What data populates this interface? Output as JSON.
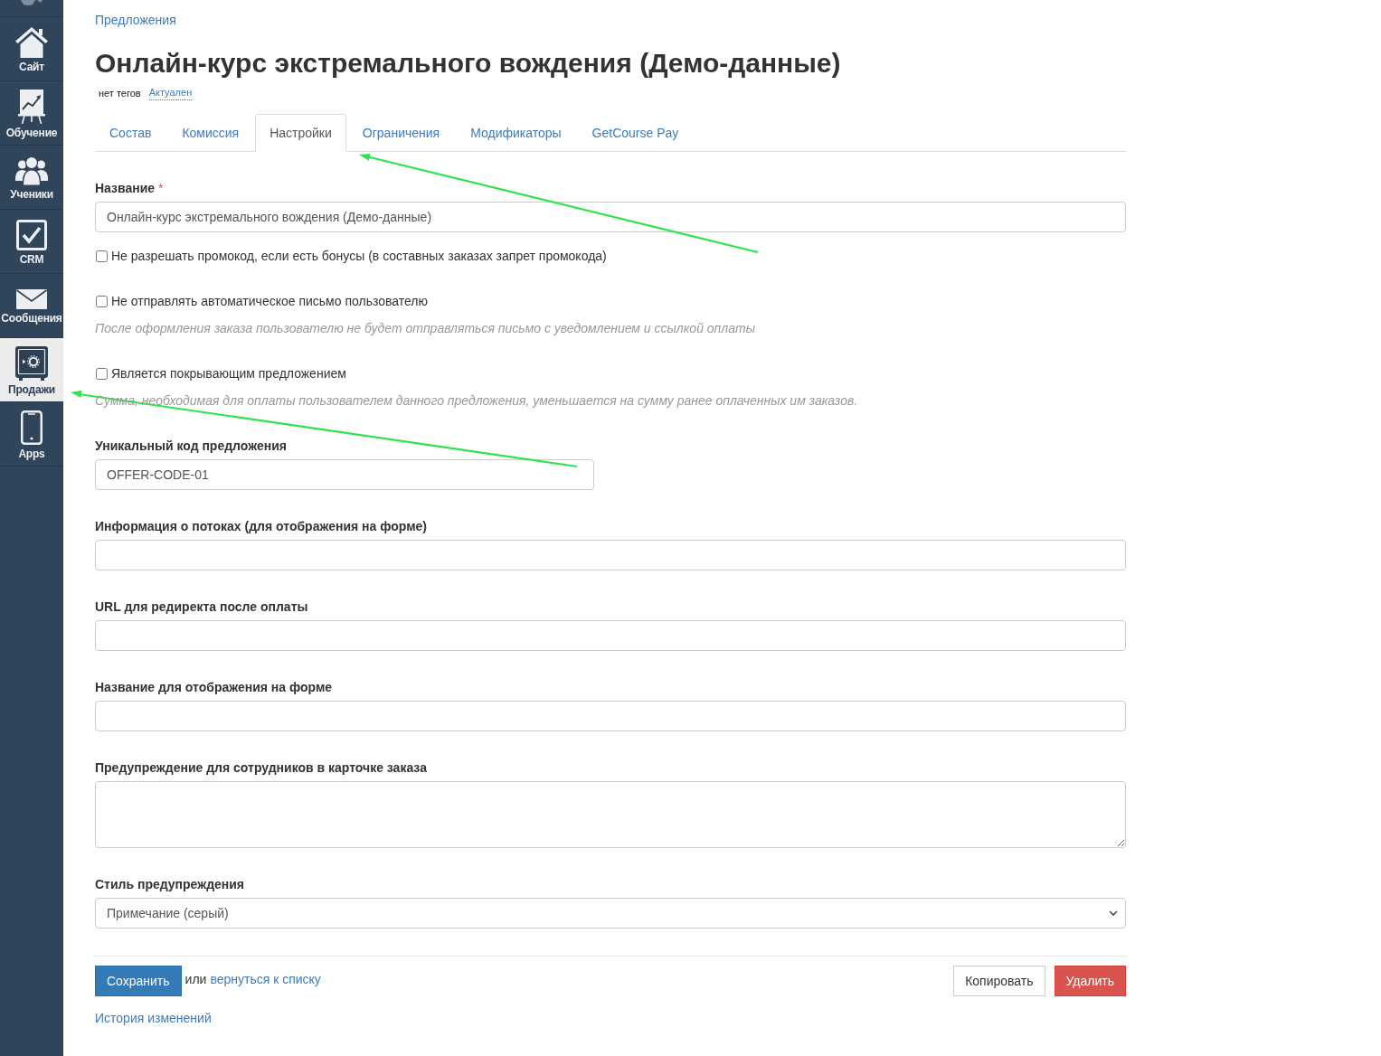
{
  "sidebar": {
    "items": [
      {
        "label": "Сайт",
        "selected": false
      },
      {
        "label": "Обучение",
        "selected": false
      },
      {
        "label": "Ученики",
        "selected": false
      },
      {
        "label": "CRM",
        "selected": false
      },
      {
        "label": "Сообщения",
        "selected": false
      },
      {
        "label": "Продажи",
        "selected": true
      },
      {
        "label": "Apps",
        "selected": false
      }
    ]
  },
  "breadcrumb": "Предложения",
  "title": "Онлайн-курс экстремального вождения (Демо-данные)",
  "tags": {
    "text": "нет тегов",
    "status": "Актуален"
  },
  "tabs": [
    {
      "label": "Состав",
      "selected": false
    },
    {
      "label": "Комиссия",
      "selected": false
    },
    {
      "label": "Настройки",
      "selected": true
    },
    {
      "label": "Ограничения",
      "selected": false
    },
    {
      "label": "Модификаторы",
      "selected": false
    },
    {
      "label": "GetCourse Pay",
      "selected": false
    }
  ],
  "form": {
    "name": {
      "label": "Название",
      "required_mark": "*",
      "value": "Онлайн-курс экстремального вождения (Демо-данные)"
    },
    "options": [
      {
        "label": "Не разрешать промокод, если есть бонусы (в составных заказах запрет промокода)",
        "checked": false
      },
      {
        "label": "Не отправлять автоматическое письмо пользователю",
        "checked": false,
        "hint": "После оформления заказа пользователю не будет отправляться письмо с уведомлением и ссылкой оплаты"
      },
      {
        "label": "Является покрывающим предложением",
        "checked": false,
        "hint": "Сумма, необходимая для оплаты пользователем данного предложения, уменьшается на сумму ранее оплаченных им заказов."
      }
    ],
    "fields": [
      {
        "kind": "short_input",
        "label": "Уникальный код предложения",
        "value": "OFFER-CODE-01"
      },
      {
        "kind": "input",
        "label": "Информация о потоках (для отображения на форме)"
      },
      {
        "kind": "input",
        "label": "URL для редиректа после оплаты"
      },
      {
        "kind": "input",
        "label": "Название для отображения на форме"
      },
      {
        "kind": "textarea",
        "label": "Предупреждение для сотрудников в карточке заказа"
      },
      {
        "kind": "select",
        "label": "Стиль предупреждения",
        "value": "Примечание (серый)"
      }
    ]
  },
  "actions": {
    "save": "Сохранить",
    "or_text": "или",
    "back_link": "вернуться к списку",
    "copy": "Копировать",
    "delete": "Удалить",
    "history_link": "История изменений"
  },
  "annotations": [
    {
      "kind": "arrow"
    },
    {
      "kind": "arrow"
    }
  ]
}
